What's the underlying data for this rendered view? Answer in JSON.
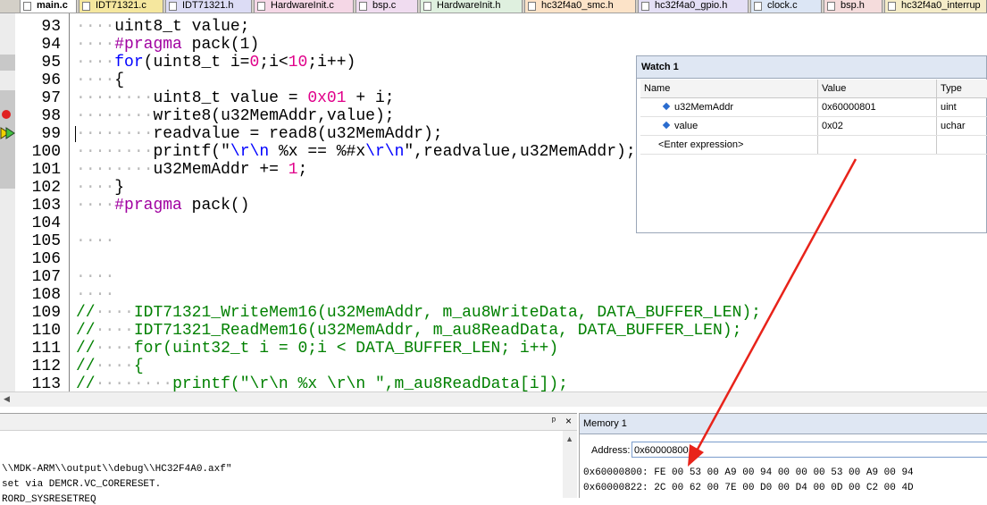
{
  "tabs": [
    {
      "label": "main.c",
      "active": true
    },
    {
      "label": "IDT71321.c"
    },
    {
      "label": "IDT71321.h"
    },
    {
      "label": "HardwareInit.c"
    },
    {
      "label": "bsp.c"
    },
    {
      "label": "HardwareInit.h"
    },
    {
      "label": "hc32f4a0_smc.h"
    },
    {
      "label": "hc32f4a0_gpio.h"
    },
    {
      "label": "clock.c"
    },
    {
      "label": "bsp.h"
    },
    {
      "label": "hc32f4a0_interrup"
    }
  ],
  "code": [
    {
      "n": "93",
      "text": "····uint8_t value;"
    },
    {
      "n": "94",
      "text": "····#pragma pack(1)"
    },
    {
      "n": "95",
      "text": "····for(uint8_t i=0;i<10;i++)"
    },
    {
      "n": "96",
      "text": "····{"
    },
    {
      "n": "97",
      "text": "········uint8_t value = 0x01 + i;"
    },
    {
      "n": "98",
      "text": "········write8(u32MemAddr,value);"
    },
    {
      "n": "99",
      "text": "········readvalue = read8(u32MemAddr);"
    },
    {
      "n": "100",
      "text": "········printf(\"\\r\\n %x == %#x\\r\\n\",readvalue,u32MemAddr);"
    },
    {
      "n": "101",
      "text": "········u32MemAddr += 1;"
    },
    {
      "n": "102",
      "text": "····}"
    },
    {
      "n": "103",
      "text": "····#pragma pack()"
    },
    {
      "n": "104",
      "text": ""
    },
    {
      "n": "105",
      "text": "····"
    },
    {
      "n": "106",
      "text": ""
    },
    {
      "n": "107",
      "text": "····"
    },
    {
      "n": "108",
      "text": "····"
    },
    {
      "n": "109",
      "text": "//····IDT71321_WriteMem16(u32MemAddr, m_au8WriteData, DATA_BUFFER_LEN);"
    },
    {
      "n": "110",
      "text": "//····IDT71321_ReadMem16(u32MemAddr, m_au8ReadData, DATA_BUFFER_LEN);"
    },
    {
      "n": "111",
      "text": "//····for(uint32_t i = 0;i < DATA_BUFFER_LEN; i++)"
    },
    {
      "n": "112",
      "text": "//····{"
    },
    {
      "n": "113",
      "text": "//········printf(\"\\r\\n %x \\r\\n \",m_au8ReadData[i]);"
    }
  ],
  "watch": {
    "title": "Watch 1",
    "headers": {
      "name": "Name",
      "value": "Value",
      "type": "Type"
    },
    "rows": [
      {
        "name": "u32MemAddr",
        "value": "0x60000801",
        "type": "uint"
      },
      {
        "name": "value",
        "value": "0x02",
        "type": "uchar"
      }
    ],
    "enter": "<Enter expression>"
  },
  "build_output": {
    "lines": [
      "\\\\MDK-ARM\\\\output\\\\debug\\\\HC32F4A0.axf\"",
      "set via DEMCR.VC_CORERESET.",
      "RORD_SYSRESETREQ"
    ],
    "pin_glyph": "ᵖ",
    "close_glyph": "×"
  },
  "memory": {
    "title": "Memory 1",
    "address_label": "Address:",
    "address_value": "0x60000800",
    "rows": [
      "0x60000800: FE 00 53 00 A9 00 94 00 00 00 53 00 A9 00 94",
      "0x60000822: 2C 00 62 00 7E 00 D0 00 D4 00 0D 00 C2 00 4D"
    ]
  },
  "colors": {
    "keyword": "#0000ff",
    "pragma": "#a000a0",
    "number": "#e0008a",
    "comment": "#008000",
    "string": "#7a007a",
    "arrow": "#e8231a"
  }
}
